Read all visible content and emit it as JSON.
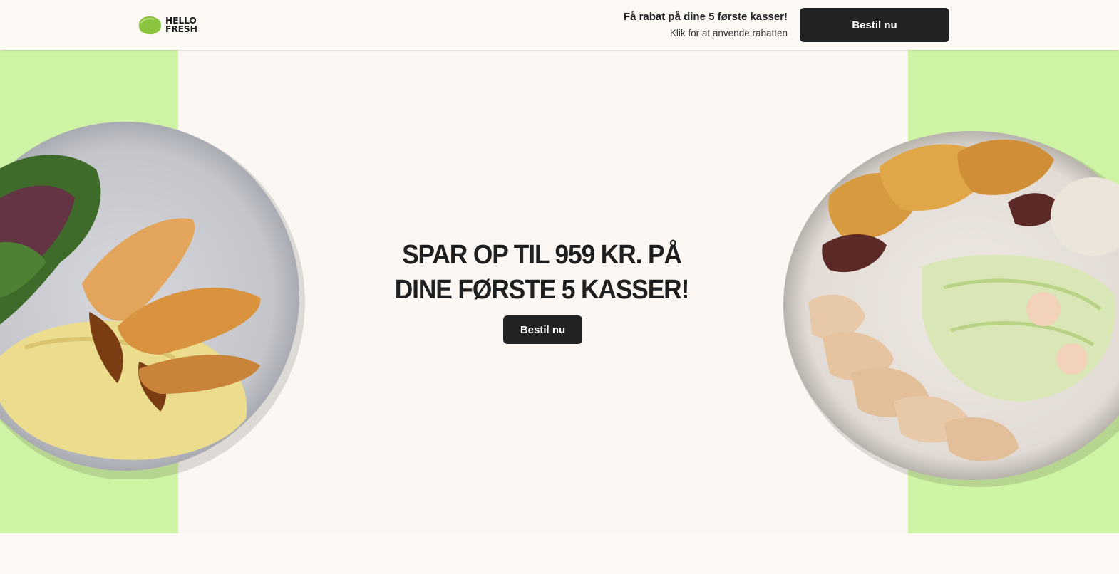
{
  "header": {
    "logo_line1": "HELLO",
    "logo_line2": "FRESH",
    "promo_title": "Få rabat på dine 5 første kasser!",
    "promo_subtitle": "Klik for at anvende rabatten",
    "cta_label": "Bestil nu"
  },
  "hero": {
    "title_line1": "SPAR OP TIL 959 KR. PÅ",
    "title_line2": "DINE FØRSTE 5 KASSER!",
    "cta_label": "Bestil nu",
    "left_image": "plate-mashed-potatoes-chicken-kale",
    "right_image": "plate-roast-potatoes-chicken-coleslaw"
  },
  "colors": {
    "accent_green": "#cff3a5",
    "button_dark": "#222222",
    "background": "#fcf7f2",
    "logo_lime": "#8bc53f"
  }
}
